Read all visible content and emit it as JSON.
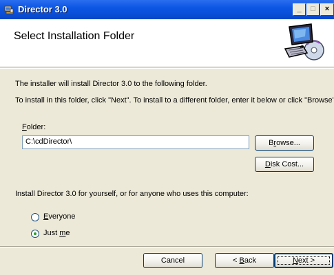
{
  "window": {
    "title": "Director 3.0",
    "controls": {
      "minimize": "_",
      "maximize": "□",
      "close": "×"
    }
  },
  "banner": {
    "heading": "Select Installation Folder",
    "art_icon": "computer-install-icon"
  },
  "body": {
    "line1": "The installer will install Director 3.0 to the following folder.",
    "line2": "To install in this folder, click \"Next\". To install to a different folder, enter it below or click \"Browse\".",
    "folder_label_hotkey": "F",
    "folder_label_rest": "older:",
    "folder_value": "C:\\cdDirector\\",
    "browse_hotkey": "r",
    "browse_pre": "B",
    "browse_post": "owse...",
    "diskcost_hotkey": "D",
    "diskcost_rest": "isk Cost...",
    "install_for": "Install Director 3.0 for yourself, or for anyone who uses this computer:",
    "options": [
      {
        "hotkey": "E",
        "rest": "veryone",
        "selected": false
      },
      {
        "pre": "Just ",
        "hotkey": "m",
        "rest": "e",
        "selected": true
      }
    ]
  },
  "footer": {
    "cancel": "Cancel",
    "back_pre": "< ",
    "back_hotkey": "B",
    "back_rest": "ack",
    "next_hotkey": "N",
    "next_rest": "ext >"
  },
  "colors": {
    "titlebar": "#0c56e4",
    "face": "#ece9d8",
    "radio_dot": "#21a121"
  }
}
